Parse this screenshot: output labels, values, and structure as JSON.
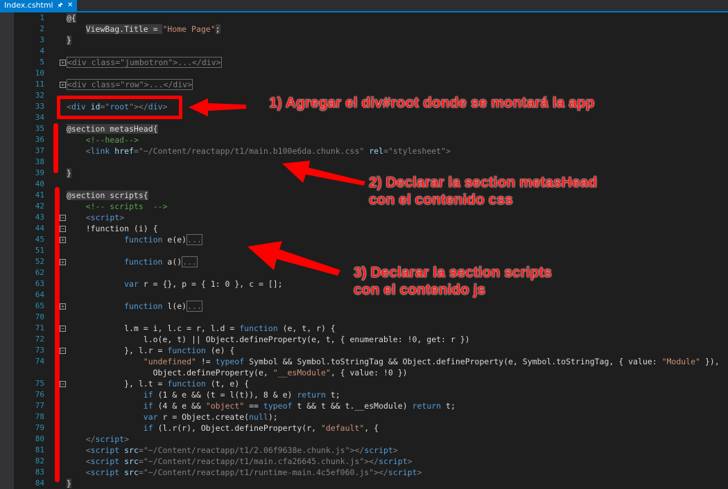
{
  "tab": {
    "title": "Index.cshtml",
    "pin_icon": "pin-icon",
    "close_icon": "close-icon"
  },
  "lines": [
    {
      "n": "1",
      "segs": [
        [
          "@{",
          "t-razor"
        ]
      ]
    },
    {
      "n": "2",
      "segs": [
        [
          "    ",
          ""
        ],
        [
          "ViewBag.Title = ",
          "t-razor"
        ],
        [
          "\"Home Page\"",
          "t-str"
        ],
        [
          ";",
          "t-razor"
        ]
      ]
    },
    {
      "n": "3",
      "segs": [
        [
          "}",
          "t-razor"
        ]
      ]
    },
    {
      "n": "4",
      "segs": []
    },
    {
      "n": "5",
      "fold": "+",
      "segs": [
        [
          "<div class=\"jumbotron\">...</div>",
          "t-collapsed"
        ]
      ]
    },
    {
      "n": "10",
      "segs": []
    },
    {
      "n": "11",
      "fold": "+",
      "segs": [
        [
          "<div class=\"row\">...</div>",
          "t-collapsed"
        ]
      ]
    },
    {
      "n": "32",
      "segs": []
    },
    {
      "n": "33",
      "segs": [
        [
          "<",
          "t-tag"
        ],
        [
          "div",
          "t-el"
        ],
        [
          " id",
          "t-attr"
        ],
        [
          "=\"",
          "t-tag"
        ],
        [
          "root",
          "t-el"
        ],
        [
          "\"></",
          "t-tag"
        ],
        [
          "div",
          "t-el"
        ],
        [
          ">",
          "t-tag"
        ]
      ]
    },
    {
      "n": "34",
      "segs": []
    },
    {
      "n": "35",
      "segs": [
        [
          "@section metasHead{",
          "t-razor"
        ]
      ]
    },
    {
      "n": "36",
      "segs": [
        [
          "    ",
          ""
        ],
        [
          "<!--head-->",
          "t-com"
        ]
      ]
    },
    {
      "n": "37",
      "segs": [
        [
          "    ",
          ""
        ],
        [
          "<",
          "t-tag"
        ],
        [
          "link",
          "t-el"
        ],
        [
          " href",
          "t-attr"
        ],
        [
          "=\"~/Content/reactapp/t1/main.b100e6da.chunk.css\"",
          "t-tag"
        ],
        [
          " rel",
          "t-attr"
        ],
        [
          "=\"stylesheet\">",
          "t-tag"
        ]
      ]
    },
    {
      "n": "38",
      "segs": []
    },
    {
      "n": "39",
      "segs": [
        [
          "}",
          "t-razor"
        ]
      ]
    },
    {
      "n": "40",
      "segs": []
    },
    {
      "n": "41",
      "segs": [
        [
          "@section scripts{",
          "t-razor"
        ]
      ]
    },
    {
      "n": "42",
      "segs": [
        [
          "    ",
          ""
        ],
        [
          "<!-- scripts  -->",
          "t-com"
        ]
      ]
    },
    {
      "n": "43",
      "fold": "-",
      "segs": [
        [
          "    ",
          ""
        ],
        [
          "<",
          "t-tag"
        ],
        [
          "script",
          "t-el"
        ],
        [
          ">",
          "t-tag"
        ]
      ]
    },
    {
      "n": "44",
      "fold": "-",
      "segs": [
        [
          "    !function (i) {",
          ""
        ]
      ]
    },
    {
      "n": "45",
      "fold": "+",
      "segs": [
        [
          "            ",
          ""
        ],
        [
          "function",
          "t-kw"
        ],
        [
          " e(e)",
          ""
        ],
        [
          "...",
          "t-dots"
        ]
      ]
    },
    {
      "n": "51",
      "segs": []
    },
    {
      "n": "52",
      "fold": "+",
      "segs": [
        [
          "            ",
          ""
        ],
        [
          "function",
          "t-kw"
        ],
        [
          " a()",
          ""
        ],
        [
          "...",
          "t-dots"
        ]
      ]
    },
    {
      "n": "62",
      "segs": []
    },
    {
      "n": "63",
      "segs": [
        [
          "            ",
          ""
        ],
        [
          "var",
          "t-kw"
        ],
        [
          " r = {}, p = { 1: 0 }, c = [];",
          ""
        ]
      ]
    },
    {
      "n": "64",
      "segs": []
    },
    {
      "n": "65",
      "fold": "+",
      "segs": [
        [
          "            ",
          ""
        ],
        [
          "function",
          "t-kw"
        ],
        [
          " l(e)",
          ""
        ],
        [
          "...",
          "t-dots"
        ]
      ]
    },
    {
      "n": "70",
      "segs": []
    },
    {
      "n": "71",
      "fold": "-",
      "segs": [
        [
          "            l.m = i, l.c = r, l.d = ",
          ""
        ],
        [
          "function",
          "t-kw"
        ],
        [
          " (e, t, r) {",
          ""
        ]
      ]
    },
    {
      "n": "72",
      "segs": [
        [
          "                l.o(e, t) || Object.defineProperty(e, t, { enumerable: !0, get: r })",
          ""
        ]
      ]
    },
    {
      "n": "73",
      "fold": "-",
      "segs": [
        [
          "            }, l.r = ",
          ""
        ],
        [
          "function",
          "t-kw"
        ],
        [
          " (e) {",
          ""
        ]
      ]
    },
    {
      "n": "74",
      "segs": [
        [
          "                ",
          ""
        ],
        [
          "\"undefined\"",
          "t-str"
        ],
        [
          " != ",
          ""
        ],
        [
          "typeof",
          "t-kw"
        ],
        [
          " Symbol && Symbol.toStringTag && Object.defineProperty(e, Symbol.toStringTag, { value: ",
          ""
        ],
        [
          "\"Module\"",
          "t-str"
        ],
        [
          " }),",
          ""
        ]
      ]
    },
    {
      "n": "",
      "segs": [
        [
          "                  Object.defineProperty(e, ",
          ""
        ],
        [
          "\"__esModule\"",
          "t-str"
        ],
        [
          ", { value: !0 })",
          ""
        ]
      ]
    },
    {
      "n": "75",
      "fold": "-",
      "segs": [
        [
          "            }, l.t = ",
          ""
        ],
        [
          "function",
          "t-kw"
        ],
        [
          " (t, e) {",
          ""
        ]
      ]
    },
    {
      "n": "76",
      "segs": [
        [
          "                ",
          ""
        ],
        [
          "if",
          "t-kw"
        ],
        [
          " (1 & e && (t = l(t)), 8 & e) ",
          ""
        ],
        [
          "return",
          "t-kw"
        ],
        [
          " t;",
          ""
        ]
      ]
    },
    {
      "n": "77",
      "segs": [
        [
          "                ",
          ""
        ],
        [
          "if",
          "t-kw"
        ],
        [
          " (4 & e && ",
          ""
        ],
        [
          "\"object\"",
          "t-str"
        ],
        [
          " == ",
          ""
        ],
        [
          "typeof",
          "t-kw"
        ],
        [
          " t && t && t.__esModule) ",
          ""
        ],
        [
          "return",
          "t-kw"
        ],
        [
          " t;",
          ""
        ]
      ]
    },
    {
      "n": "78",
      "segs": [
        [
          "                ",
          ""
        ],
        [
          "var",
          "t-kw"
        ],
        [
          " r = Object.create(",
          ""
        ],
        [
          "null",
          "t-kw"
        ],
        [
          ");",
          ""
        ]
      ]
    },
    {
      "n": "79",
      "segs": [
        [
          "                ",
          ""
        ],
        [
          "if",
          "t-kw"
        ],
        [
          " (l.r(r), Object.defineProperty(r, ",
          ""
        ],
        [
          "\"default\"",
          "t-str"
        ],
        [
          ", {",
          ""
        ]
      ]
    },
    {
      "n": "80",
      "segs": [
        [
          "    ",
          ""
        ],
        [
          "</",
          "t-tag"
        ],
        [
          "script",
          "t-el"
        ],
        [
          ">",
          "t-tag"
        ]
      ]
    },
    {
      "n": "81",
      "segs": [
        [
          "    ",
          ""
        ],
        [
          "<",
          "t-tag"
        ],
        [
          "script",
          "t-el"
        ],
        [
          " src",
          "t-attr"
        ],
        [
          "=\"~/Content/reactapp/t1/2.06f9638e.chunk.js\"></",
          "t-tag"
        ],
        [
          "script",
          "t-el"
        ],
        [
          ">",
          "t-tag"
        ]
      ]
    },
    {
      "n": "82",
      "segs": [
        [
          "    ",
          ""
        ],
        [
          "<",
          "t-tag"
        ],
        [
          "script",
          "t-el"
        ],
        [
          " src",
          "t-attr"
        ],
        [
          "=\"~/Content/reactapp/t1/main.cfa26645.chunk.js\"></",
          "t-tag"
        ],
        [
          "script",
          "t-el"
        ],
        [
          ">",
          "t-tag"
        ]
      ]
    },
    {
      "n": "83",
      "segs": [
        [
          "    ",
          ""
        ],
        [
          "<",
          "t-tag"
        ],
        [
          "script",
          "t-el"
        ],
        [
          " src",
          "t-attr"
        ],
        [
          "=\"~/Content/reactapp/t1/runtime-main.4c5ef060.js\"></",
          "t-tag"
        ],
        [
          "script",
          "t-el"
        ],
        [
          ">",
          "t-tag"
        ]
      ]
    },
    {
      "n": "84",
      "segs": [
        [
          "}",
          "t-razor"
        ]
      ]
    }
  ],
  "annotations": {
    "a1": "1) Agregar el div#root donde se montará la app",
    "a2_l1": "2) Declarar la section metasHead",
    "a2_l2": "con el contenido css",
    "a3_l1": "3) Declarar la section scripts",
    "a3_l2": "con el contenido js"
  },
  "colors": {
    "annotation": "#ff0000",
    "tab_accent": "#007acc",
    "editor_bg": "#1e1e1e"
  }
}
